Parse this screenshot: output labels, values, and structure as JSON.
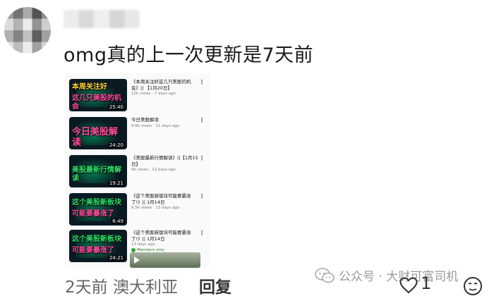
{
  "comment": {
    "text": "omg真的上一次更新是7天前"
  },
  "videos": [
    {
      "thumb_lines": [
        "本周关注好",
        "这几只美股的机会"
      ],
      "thumb_color": "pink",
      "duration": "25:40",
      "title": "《本周关注好这几只美股的机会》|| 【1月20日】",
      "meta": "22k views · 7 days ago"
    },
    {
      "thumb_lines": [
        "今日美股解读"
      ],
      "thumb_color": "pink",
      "duration": "24:20",
      "title": "今日美股解读",
      "meta": "9.6k views · 11 days ago"
    },
    {
      "thumb_lines": [
        "美股最新行情解读"
      ],
      "thumb_color": "green",
      "duration": "19:21",
      "title": "《美股最新行情解读》||【1月15日】",
      "meta": "9k views · 12 days ago"
    },
    {
      "thumb_lines": [
        "这个美股新板块",
        "可能要暴涨了"
      ],
      "thumb_color": "green",
      "duration": "6:49",
      "title": "《这个美股新版块可能要暴涨了!》|| 1月14日",
      "meta": "9.5k views · 13 days ago"
    },
    {
      "thumb_lines": [
        "这个美股新板块",
        "可能要暴涨了"
      ],
      "thumb_color": "green",
      "duration": "24:21",
      "title": "《这个美股新版块可能要暴涨了!》|| 1月14日",
      "meta": "13 days ago",
      "badge": "Members only"
    }
  ],
  "footer": {
    "time_location": "2天前 澳大利亚",
    "reply_label": "回复",
    "like_count": "1"
  },
  "watermark": {
    "text": "公众号 · 大财可富司机"
  },
  "icons": {
    "more": "kebab-menu-icon",
    "like": "heart-outline-icon",
    "emoji": "emoji-face-icon",
    "wechat": "wechat-logo-icon"
  }
}
